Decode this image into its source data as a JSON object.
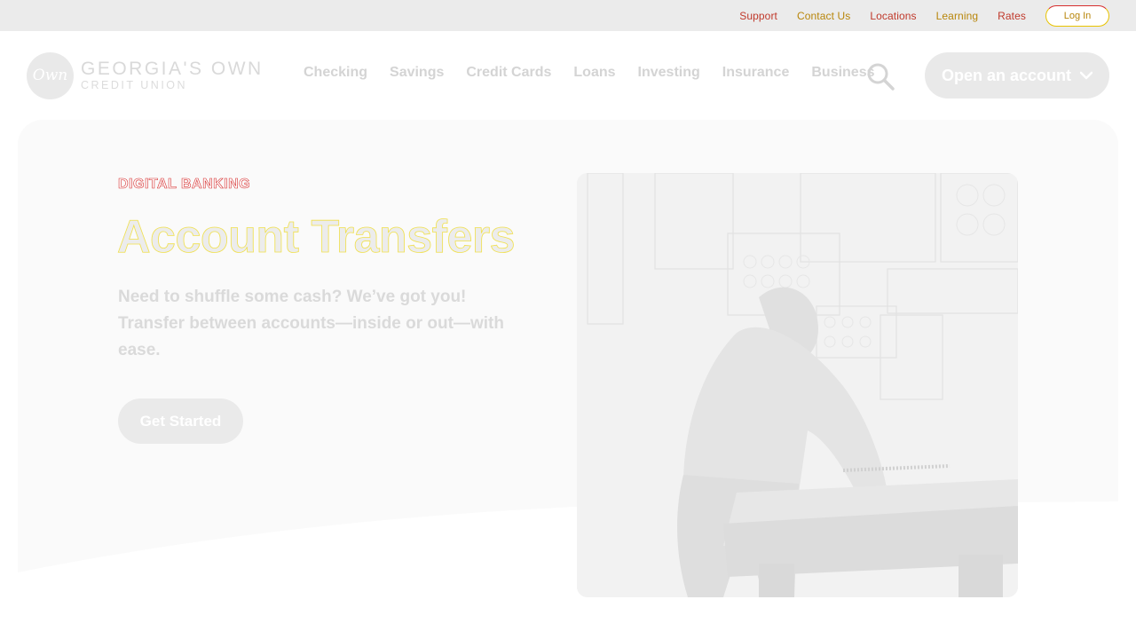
{
  "utility": {
    "links": [
      "Support",
      "Contact Us",
      "Locations",
      "Learning",
      "Rates"
    ],
    "login_label": "Log In"
  },
  "brand": {
    "mark": "Own",
    "name_line1": "GEORGIA'S OWN",
    "name_line2": "CREDIT UNION"
  },
  "nav": {
    "items": [
      "Checking",
      "Savings",
      "Credit Cards",
      "Loans",
      "Investing",
      "Insurance",
      "Business"
    ],
    "cta_label": "Open an account"
  },
  "hero": {
    "eyebrow": "DIGITAL BANKING",
    "title": "Account Transfers",
    "description": "Need to shuffle some cash? We’ve got you! Transfer between accounts—inside or out—with ease.",
    "button_label": "Get Started"
  },
  "colors": {
    "accent_red": "#d62e2e",
    "accent_yellow": "#f0e050",
    "muted_gray": "#e9e9e9"
  }
}
